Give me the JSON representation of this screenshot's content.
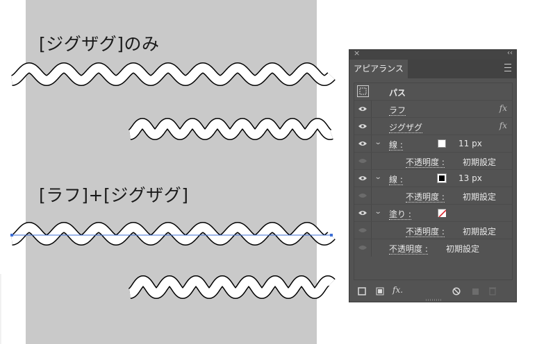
{
  "canvas": {
    "heading_1": "[ジグザグ]のみ",
    "heading_2": "[ラフ]+[ジグザグ]"
  },
  "panel": {
    "close": "×",
    "collapse": "‹‹",
    "tab_label": "アピアランス",
    "rows": {
      "path_label": "パス",
      "rough_label": "ラフ",
      "zigzag_label": "ジグザグ",
      "fx": "fx",
      "stroke1_label": "線 :",
      "stroke1_value": "11 px",
      "stroke1_color": "#ffffff",
      "opacity1_label": "不透明度 :",
      "opacity1_value": "初期設定",
      "stroke2_label": "線 :",
      "stroke2_value": "13 px",
      "stroke2_color": "#000000",
      "opacity2_label": "不透明度 :",
      "opacity2_value": "初期設定",
      "fill_label": "塗り :",
      "fill_color": "none",
      "opacity3_label": "不透明度 :",
      "opacity3_value": "初期設定",
      "opacity_main_label": "不透明度 :",
      "opacity_main_value": "初期設定"
    },
    "bottom": {
      "fx_label": "fx."
    }
  },
  "colors": {
    "panel_bg": "#535353",
    "canvas_gray": "#c9c9c9",
    "selection_blue": "#3d6fd6"
  }
}
